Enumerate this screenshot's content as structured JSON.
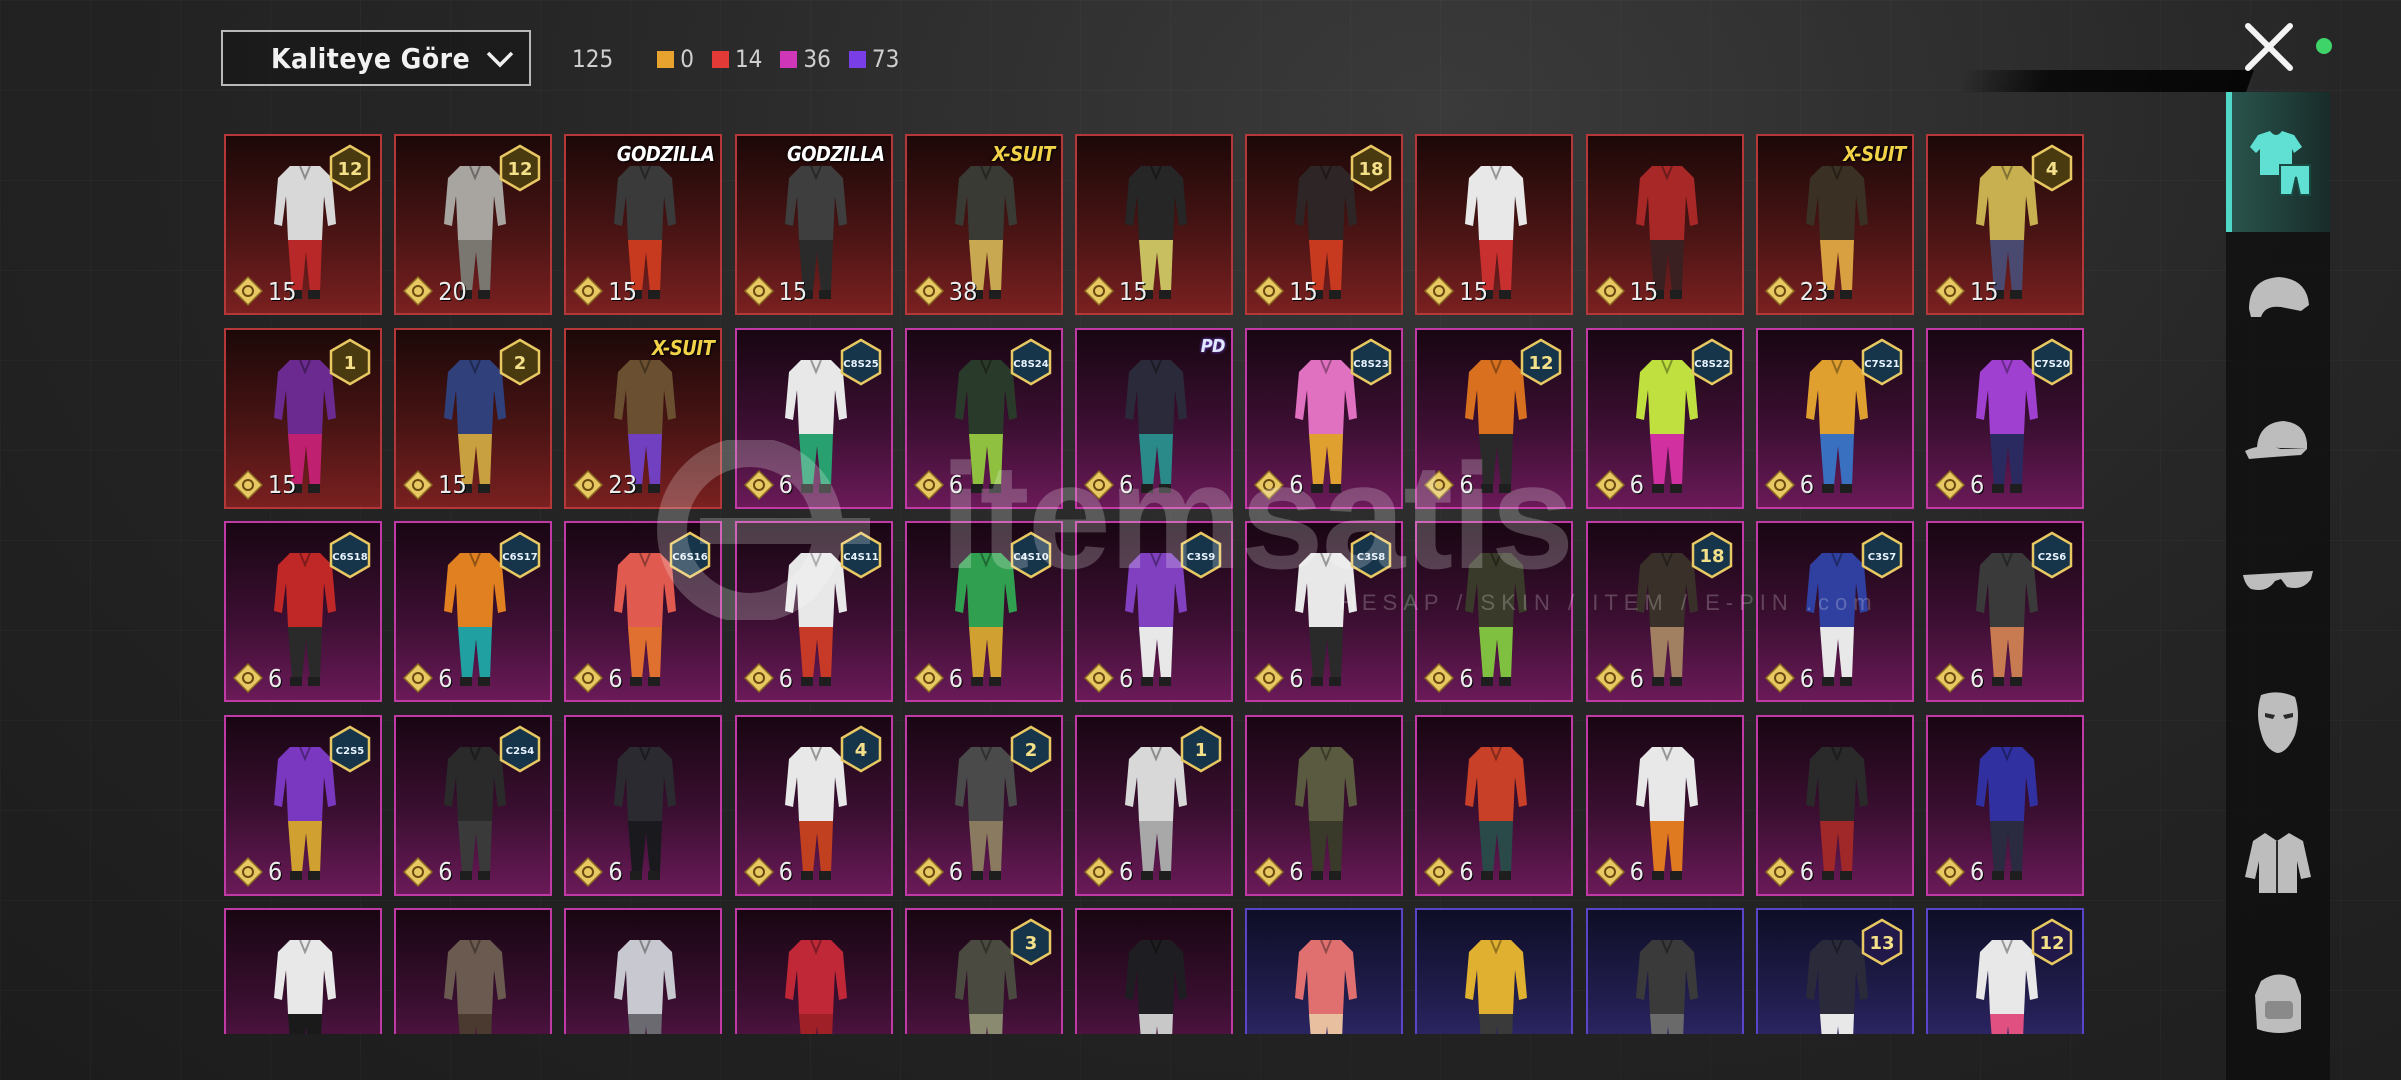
{
  "header": {
    "sort_label": "Kaliteye Göre",
    "total": "125",
    "counts": [
      {
        "value": "0",
        "color": "#e8a22e"
      },
      {
        "value": "14",
        "color": "#e23a36"
      },
      {
        "value": "36",
        "color": "#d036b8"
      },
      {
        "value": "73",
        "color": "#7a3ee6"
      }
    ]
  },
  "watermark": {
    "brand": "itemsatis",
    "tagline": "HESAP / SKIN / ITEM / E-PIN .com"
  },
  "colors": {
    "legendary": "#b4383a",
    "mythic": "#c03aa6",
    "epic": "#5a44c8",
    "active_tab": "#4fd8c6",
    "online": "#3fd46a"
  },
  "sidebar": {
    "categories": [
      {
        "name": "outfit",
        "icon": "shirt-pants-icon",
        "active": true
      },
      {
        "name": "helmet",
        "icon": "helmet-icon",
        "active": false
      },
      {
        "name": "hat",
        "icon": "cap-icon",
        "active": false
      },
      {
        "name": "glasses",
        "icon": "glasses-icon",
        "active": false
      },
      {
        "name": "mask",
        "icon": "mask-icon",
        "active": false
      },
      {
        "name": "jacket",
        "icon": "jacket-icon",
        "active": false
      },
      {
        "name": "backpack",
        "icon": "backpack-icon",
        "active": false
      }
    ]
  },
  "items": [
    {
      "q": "legendary",
      "price": "15",
      "badge": "12",
      "tag": "",
      "c1": "#d8d8d8",
      "c2": "#b82828"
    },
    {
      "q": "legendary",
      "price": "20",
      "badge": "12",
      "tag": "",
      "c1": "#a8a4a0",
      "c2": "#7a7670"
    },
    {
      "q": "legendary",
      "price": "15",
      "badge": "",
      "tag": "GODZILLA",
      "c1": "#3a3a3a",
      "c2": "#c83a20"
    },
    {
      "q": "legendary",
      "price": "15",
      "badge": "",
      "tag": "GODZILLA",
      "c1": "#3e3e3e",
      "c2": "#2a2a2a"
    },
    {
      "q": "legendary",
      "price": "38",
      "badge": "",
      "tag": "X-SUIT",
      "c1": "#3a3a34",
      "c2": "#c8a850"
    },
    {
      "q": "legendary",
      "price": "15",
      "badge": "",
      "tag": "",
      "c1": "#262626",
      "c2": "#c8c060"
    },
    {
      "q": "legendary",
      "price": "15",
      "badge": "18",
      "tag": "",
      "c1": "#2e2626",
      "c2": "#c83a20"
    },
    {
      "q": "legendary",
      "price": "15",
      "badge": "",
      "tag": "",
      "c1": "#e8e8e8",
      "c2": "#c83030"
    },
    {
      "q": "legendary",
      "price": "15",
      "badge": "",
      "tag": "",
      "c1": "#a82828",
      "c2": "#3a2020"
    },
    {
      "q": "legendary",
      "price": "23",
      "badge": "",
      "tag": "X-SUIT",
      "c1": "#3a3024",
      "c2": "#d8a040"
    },
    {
      "q": "legendary",
      "price": "15",
      "badge": "4",
      "tag": "",
      "c1": "#c8b050",
      "c2": "#4a4a70"
    },
    {
      "q": "legendary",
      "price": "15",
      "badge": "1",
      "tag": "",
      "c1": "#6a2a90",
      "c2": "#c02070"
    },
    {
      "q": "legendary",
      "price": "15",
      "badge": "2",
      "tag": "",
      "c1": "#30407a",
      "c2": "#c8a040"
    },
    {
      "q": "legendary",
      "price": "23",
      "badge": "",
      "tag": "X-SUIT",
      "c1": "#6a5030",
      "c2": "#7040c0"
    },
    {
      "q": "mythic",
      "price": "6",
      "badge": "C8S25",
      "tag": "",
      "c1": "#e8e8e8",
      "c2": "#28a070"
    },
    {
      "q": "mythic",
      "price": "6",
      "badge": "C8S24",
      "tag": "",
      "c1": "#2a3a2a",
      "c2": "#90c040"
    },
    {
      "q": "mythic",
      "price": "6",
      "badge": "",
      "tag": "PD",
      "c1": "#2a2a3a",
      "c2": "#2a8a8a"
    },
    {
      "q": "mythic",
      "price": "6",
      "badge": "C8S23",
      "tag": "",
      "c1": "#e070c0",
      "c2": "#e0a030"
    },
    {
      "q": "mythic",
      "price": "6",
      "badge": "12",
      "tag": "",
      "c1": "#d87020",
      "c2": "#2a2a2a"
    },
    {
      "q": "mythic",
      "price": "6",
      "badge": "C8S22",
      "tag": "",
      "c1": "#c0e040",
      "c2": "#d030a0"
    },
    {
      "q": "mythic",
      "price": "6",
      "badge": "C7S21",
      "tag": "",
      "c1": "#e0a030",
      "c2": "#3a70c0"
    },
    {
      "q": "mythic",
      "price": "6",
      "badge": "C7S20",
      "tag": "",
      "c1": "#a040d0",
      "c2": "#2a2a60"
    },
    {
      "q": "mythic",
      "price": "6",
      "badge": "C6S18",
      "tag": "",
      "c1": "#c02828",
      "c2": "#2a2a2a"
    },
    {
      "q": "mythic",
      "price": "6",
      "badge": "C6S17",
      "tag": "",
      "c1": "#e08020",
      "c2": "#20a0a0"
    },
    {
      "q": "mythic",
      "price": "6",
      "badge": "C6S16",
      "tag": "",
      "c1": "#e05a50",
      "c2": "#e07030"
    },
    {
      "q": "mythic",
      "price": "6",
      "badge": "C4S11",
      "tag": "",
      "c1": "#e8e8e8",
      "c2": "#c83a28"
    },
    {
      "q": "mythic",
      "price": "6",
      "badge": "C4S10",
      "tag": "",
      "c1": "#30a050",
      "c2": "#d0a030"
    },
    {
      "q": "mythic",
      "price": "6",
      "badge": "C3S9",
      "tag": "",
      "c1": "#8040c0",
      "c2": "#e8e8e8"
    },
    {
      "q": "mythic",
      "price": "6",
      "badge": "C3S8",
      "tag": "",
      "c1": "#e8e8e8",
      "c2": "#2a2a2a"
    },
    {
      "q": "mythic",
      "price": "6",
      "badge": "",
      "tag": "",
      "c1": "#3a3a2a",
      "c2": "#80c040"
    },
    {
      "q": "mythic",
      "price": "6",
      "badge": "18",
      "tag": "",
      "c1": "#3a302a",
      "c2": "#a08060"
    },
    {
      "q": "mythic",
      "price": "6",
      "badge": "C3S7",
      "tag": "",
      "c1": "#3040a0",
      "c2": "#e8e8e8"
    },
    {
      "q": "mythic",
      "price": "6",
      "badge": "C2S6",
      "tag": "",
      "c1": "#3a3a3a",
      "c2": "#c87a50"
    },
    {
      "q": "mythic",
      "price": "6",
      "badge": "C2S5",
      "tag": "",
      "c1": "#7a38c0",
      "c2": "#d0a030"
    },
    {
      "q": "mythic",
      "price": "6",
      "badge": "C2S4",
      "tag": "",
      "c1": "#2a2a2a",
      "c2": "#3a3a3a"
    },
    {
      "q": "mythic",
      "price": "6",
      "badge": "",
      "tag": "",
      "c1": "#2a2a30",
      "c2": "#1a1a1e"
    },
    {
      "q": "mythic",
      "price": "6",
      "badge": "4",
      "tag": "",
      "c1": "#e8e8e8",
      "c2": "#c04020"
    },
    {
      "q": "mythic",
      "price": "6",
      "badge": "2",
      "tag": "",
      "c1": "#4a4a4a",
      "c2": "#8a7a60"
    },
    {
      "q": "mythic",
      "price": "6",
      "badge": "1",
      "tag": "",
      "c1": "#d8d8d8",
      "c2": "#a8a8a8"
    },
    {
      "q": "mythic",
      "price": "6",
      "badge": "",
      "tag": "",
      "c1": "#5a5a40",
      "c2": "#3a3a2a"
    },
    {
      "q": "mythic",
      "price": "6",
      "badge": "",
      "tag": "",
      "c1": "#c84028",
      "c2": "#2a4a4a"
    },
    {
      "q": "mythic",
      "price": "6",
      "badge": "",
      "tag": "",
      "c1": "#e8e8e8",
      "c2": "#e07a20"
    },
    {
      "q": "mythic",
      "price": "6",
      "badge": "",
      "tag": "",
      "c1": "#2a2a2a",
      "c2": "#a02828"
    },
    {
      "q": "mythic",
      "price": "6",
      "badge": "",
      "tag": "",
      "c1": "#3030a0",
      "c2": "#2a2a40"
    },
    {
      "q": "mythic",
      "price": "",
      "badge": "",
      "tag": "",
      "c1": "#e8e8e8",
      "c2": "#1a1a1a"
    },
    {
      "q": "mythic",
      "price": "",
      "badge": "",
      "tag": "",
      "c1": "#6a5a50",
      "c2": "#4a3a30"
    },
    {
      "q": "mythic",
      "price": "",
      "badge": "",
      "tag": "",
      "c1": "#c8c8d0",
      "c2": "#6a6a70"
    },
    {
      "q": "mythic",
      "price": "",
      "badge": "",
      "tag": "",
      "c1": "#c02838",
      "c2": "#a02028"
    },
    {
      "q": "mythic",
      "price": "",
      "badge": "3",
      "tag": "",
      "c1": "#4a4a40",
      "c2": "#8a8a70"
    },
    {
      "q": "mythic",
      "price": "",
      "badge": "",
      "tag": "",
      "c1": "#1e1e22",
      "c2": "#c8c8c8"
    },
    {
      "q": "epic",
      "price": "",
      "badge": "",
      "tag": "",
      "c1": "#e07070",
      "c2": "#e8c0a0"
    },
    {
      "q": "epic",
      "price": "",
      "badge": "",
      "tag": "",
      "c1": "#e0b030",
      "c2": "#3a3a3a"
    },
    {
      "q": "epic",
      "price": "",
      "badge": "",
      "tag": "",
      "c1": "#3a3a3a",
      "c2": "#6a6a6a"
    },
    {
      "q": "epic",
      "price": "",
      "badge": "13",
      "tag": "",
      "c1": "#2a2a3a",
      "c2": "#e8e8e8"
    },
    {
      "q": "epic",
      "price": "",
      "badge": "12",
      "tag": "",
      "c1": "#e8e8e8",
      "c2": "#e05080"
    }
  ]
}
